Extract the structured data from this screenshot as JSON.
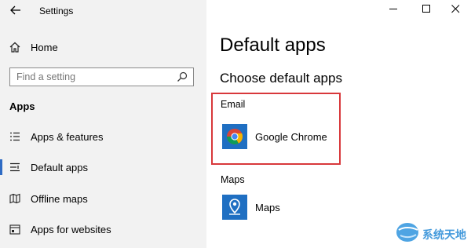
{
  "window": {
    "title": "Settings",
    "controls": {
      "minimize": "minimize-icon",
      "maximize": "maximize-icon",
      "close": "close-icon"
    }
  },
  "sidebar": {
    "home_label": "Home",
    "search": {
      "placeholder": "Find a setting",
      "value": ""
    },
    "section_heading": "Apps",
    "items": [
      {
        "label": "Apps & features",
        "icon": "list-icon",
        "active": false
      },
      {
        "label": "Default apps",
        "icon": "default-apps-icon",
        "active": true
      },
      {
        "label": "Offline maps",
        "icon": "offline-map-icon",
        "active": false
      },
      {
        "label": "Apps for websites",
        "icon": "website-apps-icon",
        "active": false
      }
    ]
  },
  "main": {
    "title": "Default apps",
    "subheading": "Choose default apps",
    "sections": [
      {
        "category": "Email",
        "app_name": "Google Chrome",
        "app_icon": "chrome-icon"
      },
      {
        "category": "Maps",
        "app_name": "Maps",
        "app_icon": "maps-icon"
      }
    ]
  },
  "watermark": {
    "text": "系统天地"
  },
  "colors": {
    "sidebar_bg": "#f2f2f2",
    "accent": "#2e6bc4",
    "highlight": "#d8383b",
    "tile_bg": "#1f6fc2"
  }
}
